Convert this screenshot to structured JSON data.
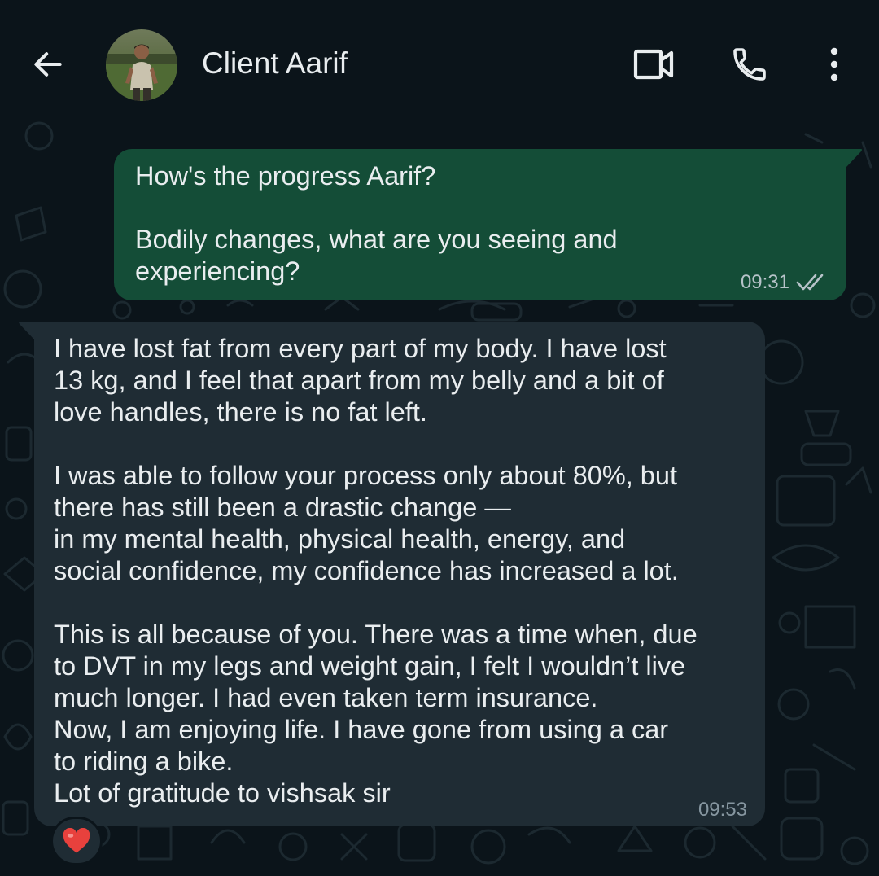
{
  "header": {
    "contact_name": "Client Aarif"
  },
  "icons": {
    "back": "arrow-left-icon",
    "video": "video-camera-icon",
    "call": "phone-icon",
    "menu": "more-vertical-icon",
    "read_receipt": "double-check-icon",
    "reaction": "heart-icon"
  },
  "messages": [
    {
      "direction": "outgoing",
      "text": "How's the progress Aarif?\n\nBodily changes, what are you seeing and\nexperiencing?",
      "time": "09:31",
      "status": "read"
    },
    {
      "direction": "incoming",
      "text": "I have lost fat from every part of my body. I have lost\n13 kg, and I feel that apart from my belly and a bit of\nlove handles, there is no fat left.\n\nI was able to follow your process only about 80%, but\nthere has still been a drastic change —\nin my mental health, physical health, energy, and\nsocial confidence, my confidence has increased a lot.\n\nThis is all because of you. There was a time when, due\nto DVT in my legs and weight gain, I felt I wouldn’t live\nmuch longer. I had even taken term insurance.\nNow, I am enjoying life. I have gone from using a car\nto riding a bike.\nLot of gratitude to vishsak sir",
      "time": "09:53",
      "reaction": "❤️"
    }
  ],
  "colors": {
    "background": "#0b141a",
    "outgoing_bubble": "#144d37",
    "incoming_bubble": "#1f2c34",
    "text": "#e9edef",
    "meta_text": "#8696a0",
    "read_tick": "#b7c3c9",
    "heart": "#e8413d"
  }
}
